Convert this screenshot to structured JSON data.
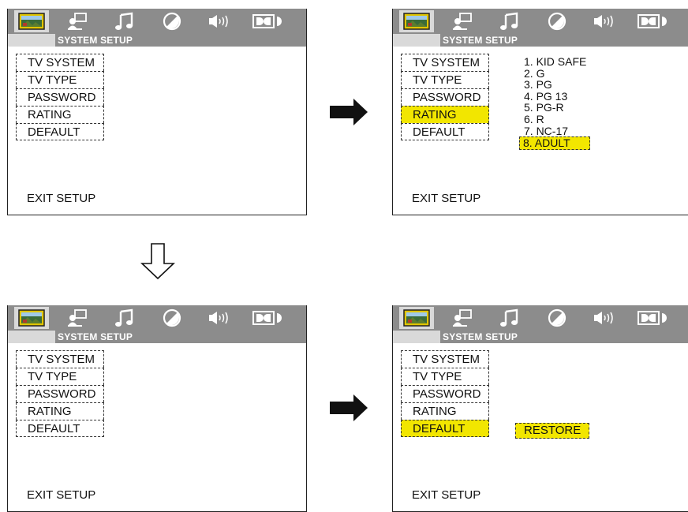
{
  "menu": {
    "subtitle": "SYSTEM SETUP",
    "items": [
      "TV SYSTEM",
      "TV TYPE",
      "PASSWORD",
      "RATING",
      "DEFAULT"
    ],
    "exit_label": "EXIT SETUP"
  },
  "tabs": [
    "picture-icon",
    "monitor-icon",
    "music-note-icon",
    "contrast-icon",
    "speaker-icon",
    "dolby-icon"
  ],
  "rating_options": [
    "1. KID SAFE",
    "2. G",
    "3. PG",
    "4. PG 13",
    "5. PG-R",
    "6. R",
    "7. NC-17",
    "8. ADULT"
  ],
  "restore_label": "RESTORE",
  "colors": {
    "highlight": "#f2e600",
    "bar": "#8c8c8c",
    "tab_selected": "#d9d9d9"
  },
  "panels": {
    "top_left": {
      "highlight_item": ""
    },
    "top_right": {
      "highlight_item": "RATING",
      "highlight_option": "8. ADULT"
    },
    "bottom_left": {
      "highlight_item": ""
    },
    "bottom_right": {
      "highlight_item": "DEFAULT",
      "popup": "RESTORE"
    }
  }
}
